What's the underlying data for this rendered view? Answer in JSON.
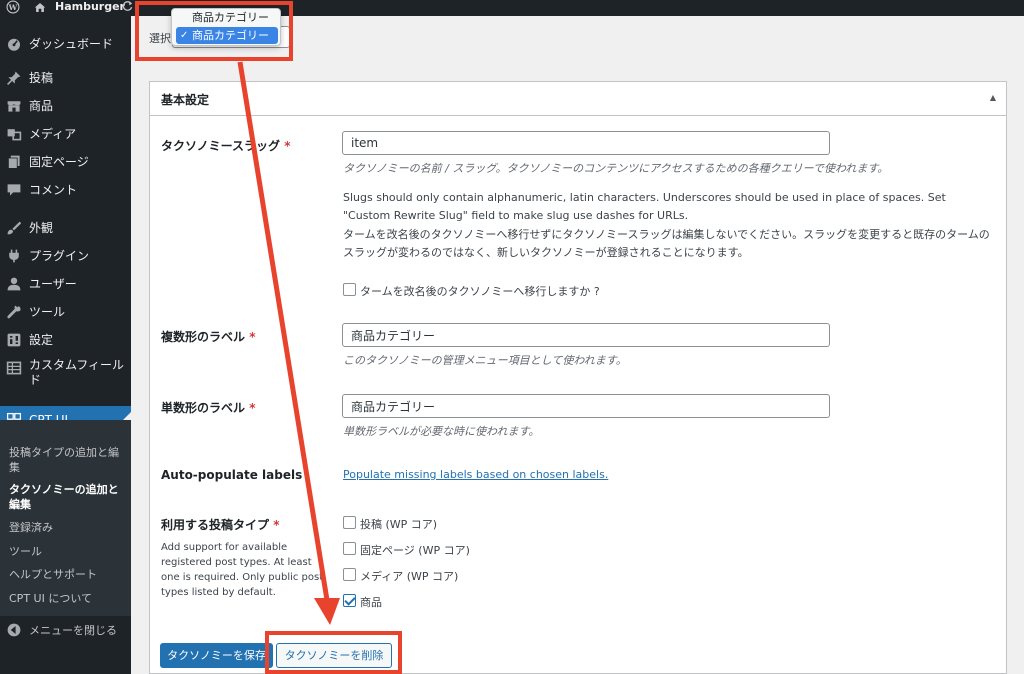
{
  "adminbar": {
    "site_name": "Hamburger"
  },
  "sidebar": {
    "items": [
      {
        "label": "ダッシュボード",
        "icon": "dashboard-icon"
      },
      {
        "label": "投稿",
        "icon": "pin-icon"
      },
      {
        "label": "商品",
        "icon": "store-icon"
      },
      {
        "label": "メディア",
        "icon": "media-icon"
      },
      {
        "label": "固定ページ",
        "icon": "page-icon"
      },
      {
        "label": "コメント",
        "icon": "comment-icon"
      },
      {
        "label": "外観",
        "icon": "brush-icon"
      },
      {
        "label": "プラグイン",
        "icon": "plugin-icon"
      },
      {
        "label": "ユーザー",
        "icon": "user-icon"
      },
      {
        "label": "ツール",
        "icon": "wrench-icon"
      },
      {
        "label": "設定",
        "icon": "settings-icon"
      },
      {
        "label": "カスタムフィールド",
        "icon": "table-icon"
      }
    ],
    "cptui": {
      "label": "CPT UI",
      "icon": "cptui-icon"
    },
    "submenu": [
      {
        "label": "投稿タイプの追加と編集"
      },
      {
        "label": "タクソノミーの追加と編集"
      },
      {
        "label": "登録済み"
      },
      {
        "label": "ツール"
      },
      {
        "label": "ヘルプとサポート"
      },
      {
        "label": "CPT UI について"
      }
    ],
    "collapse_label": "メニューを閉じる"
  },
  "select": {
    "label": "選択",
    "options": [
      "商品カテゴリー",
      "商品カテゴリー"
    ],
    "selected_check": "✓"
  },
  "panel": {
    "title": "基本設定",
    "slug": {
      "label": "タクソノミースラッグ",
      "required": "*",
      "value": "item",
      "desc": "タクソノミーの名前 / スラッグ。タクソノミーのコンテンツにアクセスするための各種クエリーで使われます。",
      "note_en": "Slugs should only contain alphanumeric, latin characters. Underscores should be used in place of spaces. Set \"Custom Rewrite Slug\" field to make slug use dashes for URLs.",
      "note_ja": "タームを改名後のタクソノミーへ移行せずにタクソノミースラッグは編集しないでください。スラッグを変更すると既存のタームのスラッグが変わるのではなく、新しいタクソノミーが登録されることになります。",
      "migrate_label": "タームを改名後のタクソノミーへ移行しますか ?"
    },
    "plural": {
      "label": "複数形のラベル",
      "required": "*",
      "value": "商品カテゴリー",
      "desc": "このタクソノミーの管理メニュー項目として使われます。"
    },
    "singular": {
      "label": "単数形のラベル",
      "required": "*",
      "value": "商品カテゴリー",
      "desc": "単数形ラベルが必要な時に使われます。"
    },
    "autopop": {
      "label": "Auto-populate labels",
      "link": "Populate missing labels based on chosen labels."
    },
    "post_types": {
      "label": "利用する投稿タイプ",
      "required": "*",
      "desc": "Add support for available registered post types. At least one is required. Only public post types listed by default.",
      "options": [
        {
          "label": "投稿 (WP コア)",
          "checked": false
        },
        {
          "label": "固定ページ (WP コア)",
          "checked": false
        },
        {
          "label": "メディア (WP コア)",
          "checked": false
        },
        {
          "label": "商品",
          "checked": true
        }
      ]
    },
    "buttons": {
      "save": "タクソノミーを保存",
      "delete": "タクソノミーを削除"
    }
  },
  "colors": {
    "admin_dark": "#1d2327",
    "accent": "#2271b1",
    "annotation_red": "#e8432d"
  }
}
